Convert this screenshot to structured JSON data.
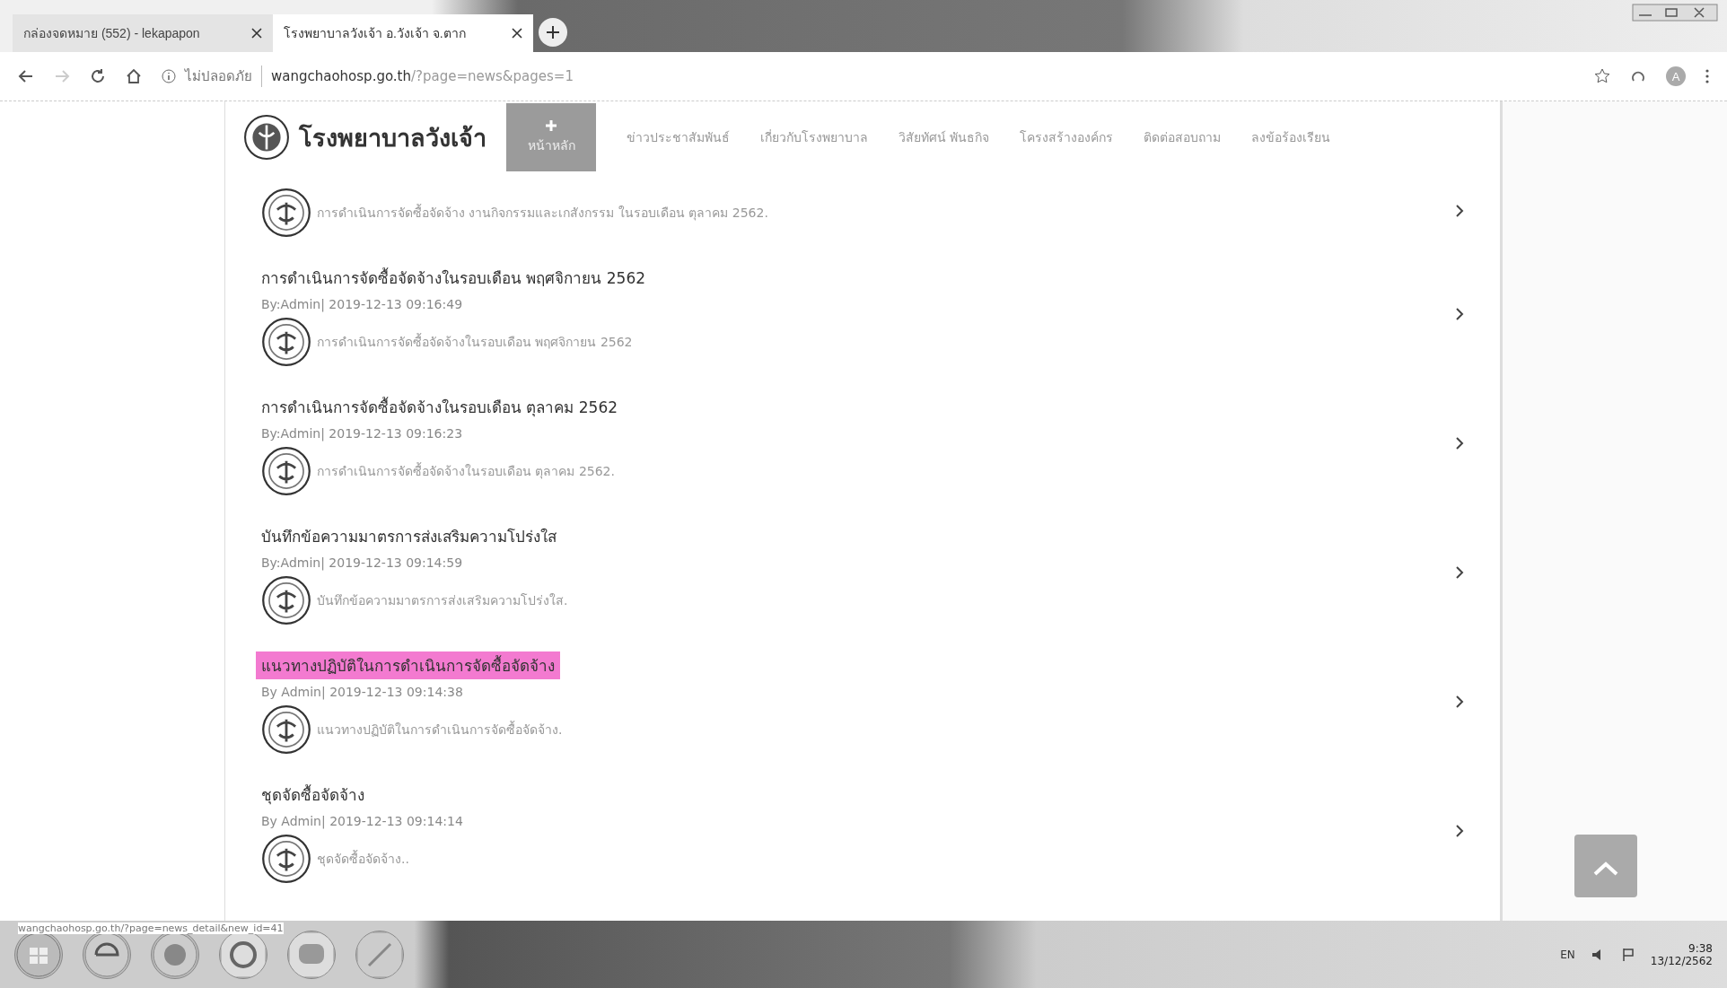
{
  "browser": {
    "tabs": [
      {
        "title": "กล่องจดหมาย (552) - lekapapon",
        "selected": false
      },
      {
        "title": "โรงพยาบาลวังเจ้า อ.วังเจ้า จ.ตาก",
        "selected": true
      }
    ],
    "security": "ไม่ปลอดภัย",
    "url_host": "wangchaohosp.go.th",
    "url_path": "/?page=news&pages=1",
    "profile": "A"
  },
  "site": {
    "name": "โรงพยาบาลวังเจ้า",
    "nav": [
      {
        "label": "หน้าหลัก",
        "selected": true
      },
      {
        "label": "ข่าวประชาสัมพันธ์",
        "selected": false
      },
      {
        "label": "เกี่ยวกับโรงพยาบาล",
        "selected": false
      },
      {
        "label": "วิสัยทัศน์ พันธกิจ",
        "selected": false
      },
      {
        "label": "โครงสร้างองค์กร",
        "selected": false
      },
      {
        "label": "ติดต่อสอบถาม",
        "selected": false
      },
      {
        "label": "ลงข้อร้องเรียน",
        "selected": false
      }
    ]
  },
  "news": [
    {
      "excerpt": "การดำเนินการจัดซื้อจัดจ้าง งานกิจกรรมและเกสังกรรม ในรอบเดือน ตุลาคม 2562.",
      "highlighted": false
    },
    {
      "title": "การดำเนินการจัดซื้อจัดจ้างในรอบเดือน พฤศจิกายน 2562",
      "meta": "By:Admin| 2019-12-13 09:16:49",
      "excerpt": "การดำเนินการจัดซื้อจัดจ้างในรอบเดือน พฤศจิกายน 2562",
      "highlighted": false
    },
    {
      "title": "การดำเนินการจัดซื้อจัดจ้างในรอบเดือน ตุลาคม 2562",
      "meta": "By:Admin| 2019-12-13 09:16:23",
      "excerpt": "การดำเนินการจัดซื้อจัดจ้างในรอบเดือน ตุลาคม 2562.",
      "highlighted": false
    },
    {
      "title": "บันทึกข้อความมาตรการส่งเสริมความโปร่งใส",
      "meta": "By:Admin| 2019-12-13 09:14:59",
      "excerpt": "บันทึกข้อความมาตรการส่งเสริมความโปร่งใส.",
      "highlighted": false
    },
    {
      "title": "แนวทางปฏิบัติในการดำเนินการจัดซื้อจัดจ้าง",
      "meta": "By Admin| 2019-12-13 09:14:38",
      "excerpt": "แนวทางปฏิบัติในการดำเนินการจัดซื้อจัดจ้าง.",
      "highlighted": true
    },
    {
      "title": "ชุดจัดซื้อจัดจ้าง",
      "meta": "By Admin| 2019-12-13 09:14:14",
      "excerpt": "ชุดจัดซื้อจัดจ้าง..",
      "highlighted": false
    }
  ],
  "status_url": "wangchaohosp.go.th/?page=news_detail&new_id=41",
  "taskbar": {
    "language": "EN",
    "time": "9:38",
    "date": "13/12/2562"
  }
}
